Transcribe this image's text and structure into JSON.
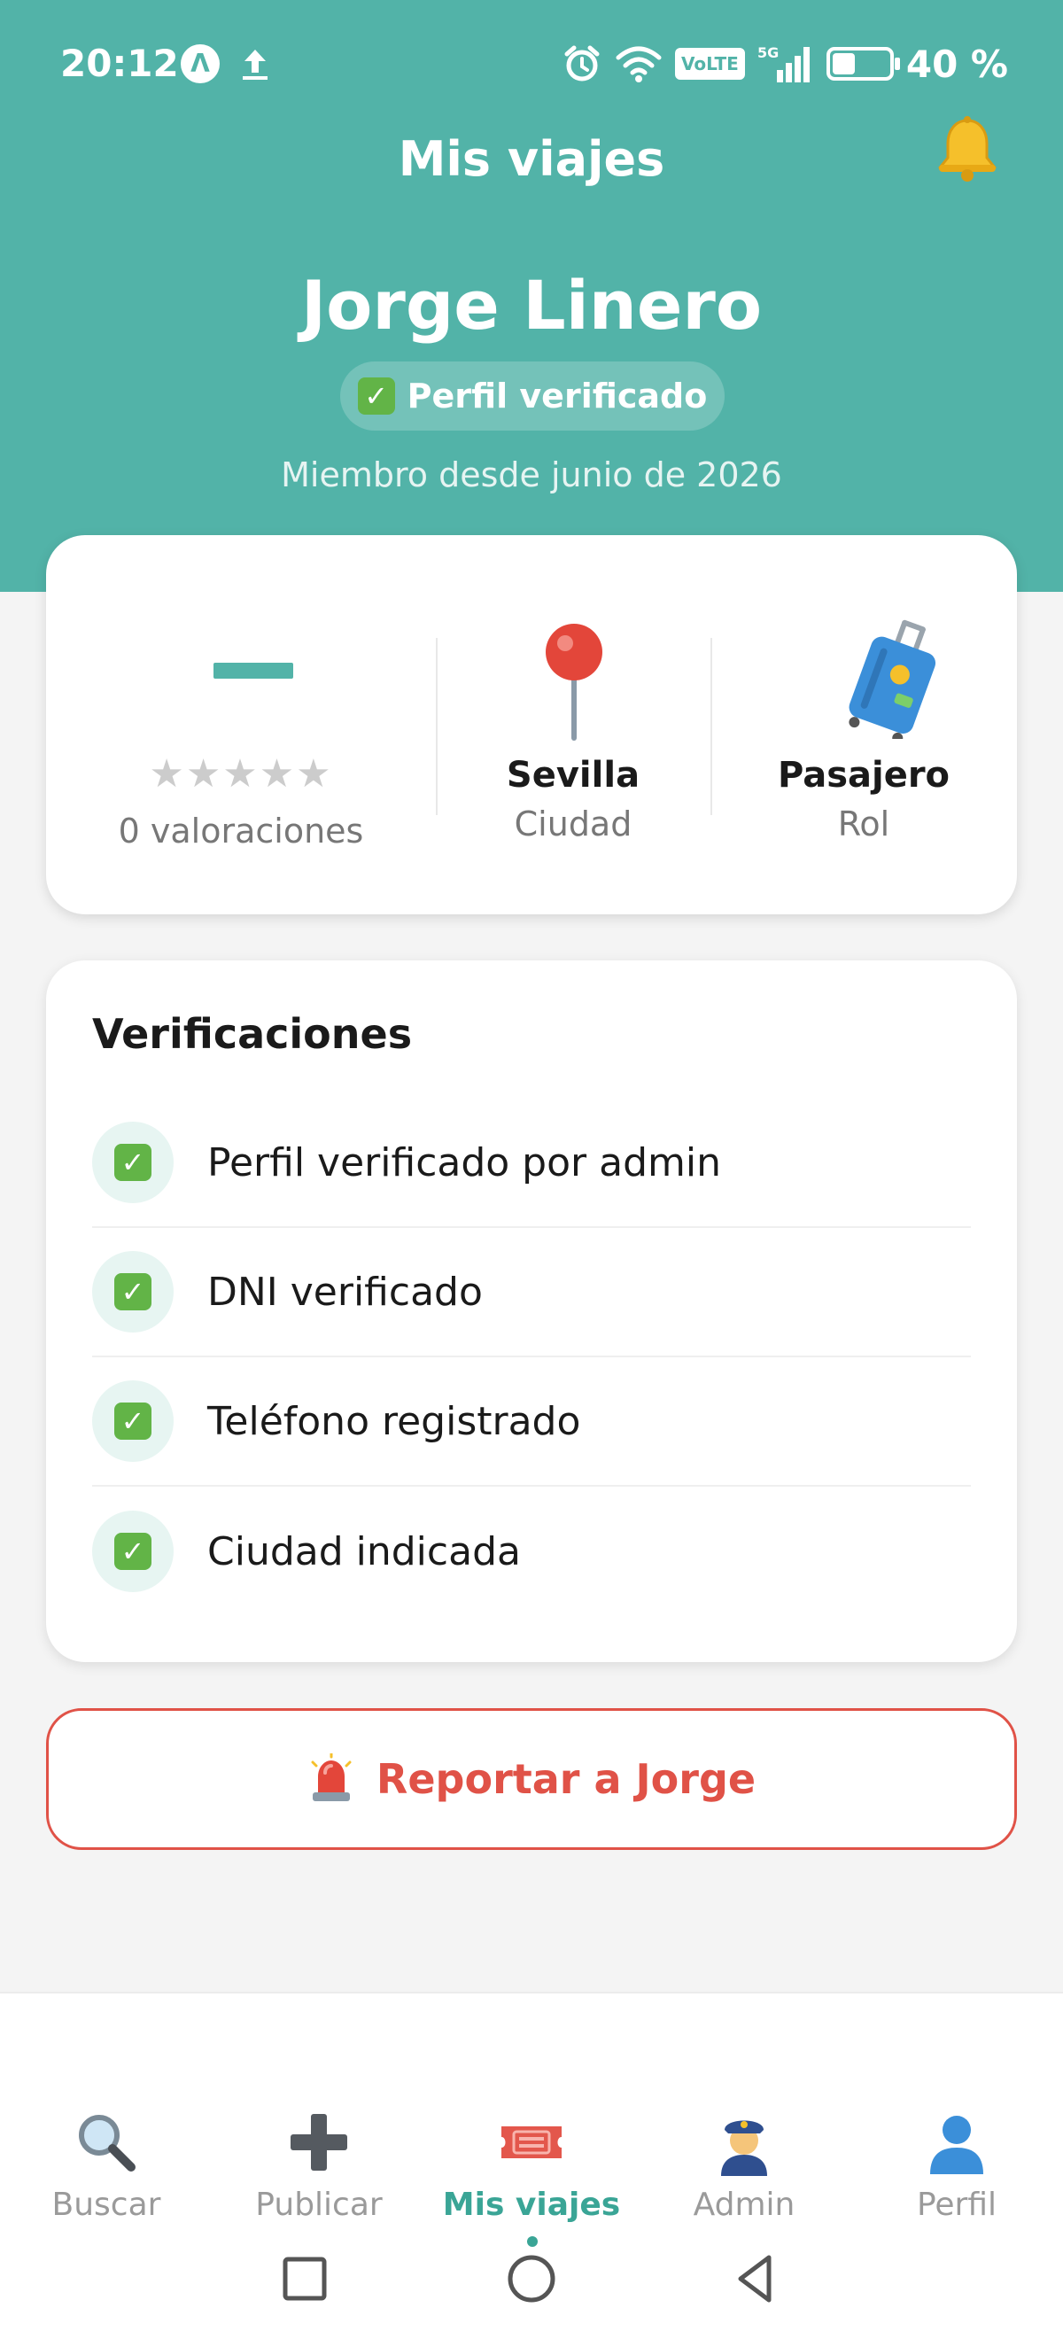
{
  "status_bar": {
    "time": "20:12",
    "battery_text": "40 %",
    "battery_level": 0.4,
    "volte": "VoLTE",
    "network": "5G"
  },
  "header": {
    "title": "Mis viajes"
  },
  "profile": {
    "name": "Jorge Linero",
    "verified_label": "Perfil verificado",
    "member_since": "Miembro desde junio de 2026"
  },
  "stats": {
    "stars": "★★★★★",
    "ratings_count": "0 valoraciones",
    "city_value": "Sevilla",
    "city_label": "Ciudad",
    "role_value": "Pasajero",
    "role_label": "Rol"
  },
  "verifications": {
    "title": "Verificaciones",
    "items": [
      {
        "label": "Perfil verificado por admin"
      },
      {
        "label": "DNI verificado"
      },
      {
        "label": "Teléfono registrado"
      },
      {
        "label": "Ciudad indicada"
      }
    ]
  },
  "report": {
    "label": "Reportar a Jorge"
  },
  "bottom_nav": {
    "items": [
      {
        "label": "Buscar",
        "icon": "search-icon"
      },
      {
        "label": "Publicar",
        "icon": "plus-icon"
      },
      {
        "label": "Mis viajes",
        "icon": "ticket-icon",
        "active": true
      },
      {
        "label": "Admin",
        "icon": "police-officer-icon"
      },
      {
        "label": "Perfil",
        "icon": "user-silhouette-icon"
      }
    ]
  },
  "colors": {
    "primary": "#52b3a8",
    "danger": "#e05247",
    "check": "#62b447"
  }
}
